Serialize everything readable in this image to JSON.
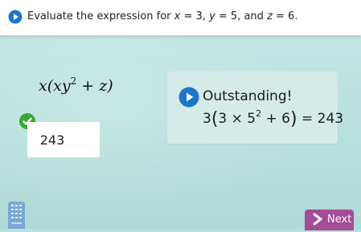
{
  "header": {
    "prompt_prefix": "Evaluate the expression for ",
    "var_x": "x",
    "eq_x": " = 3, ",
    "var_y": "y",
    "eq_y": " = 5, and ",
    "var_z": "z",
    "eq_z": " = 6.",
    "icon": "play-icon"
  },
  "expression": {
    "part1": "x(xy",
    "exponent": "2",
    "part2": " + z)"
  },
  "answer": {
    "value": "243",
    "status_icon": "check-icon"
  },
  "feedback": {
    "title": "Outstanding!",
    "eq_lead": "3",
    "open_paren": "(",
    "eq_mid": "3 × 5",
    "exponent": "2",
    "eq_tail": " + 6",
    "close_paren": ")",
    "eq_result": " = 243",
    "icon": "play-icon"
  },
  "footer": {
    "calculator_icon": "calculator-icon",
    "next_label": "Next",
    "next_icon": "arrow-right-icon"
  },
  "colors": {
    "background": "#b7dfdc",
    "feedback_panel": "#d5ebe7",
    "play_icon": "#1f76c8",
    "check": "#3aa838",
    "next_button": "#a54b97",
    "calculator": "#7aa7d6"
  }
}
